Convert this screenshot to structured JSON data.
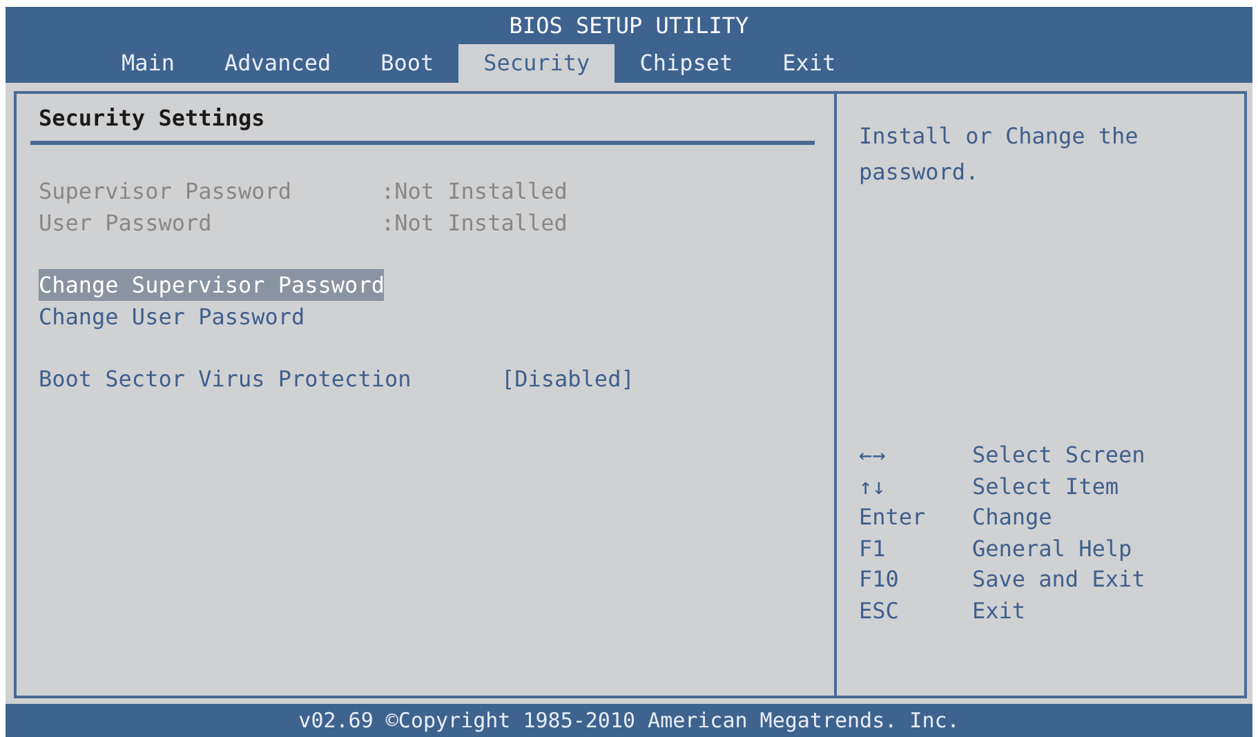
{
  "window": {
    "title": "BIOS SETUP UTILITY"
  },
  "tabs": [
    {
      "label": "Main",
      "selected": false
    },
    {
      "label": "Advanced",
      "selected": false
    },
    {
      "label": "Boot",
      "selected": false
    },
    {
      "label": "Security",
      "selected": true
    },
    {
      "label": "Chipset",
      "selected": false
    },
    {
      "label": "Exit",
      "selected": false
    }
  ],
  "panel": {
    "title": "Security Settings",
    "items": [
      {
        "kind": "info",
        "label": "Supervisor Password",
        "value": ":Not Installed",
        "selected": false
      },
      {
        "kind": "info",
        "label": "User Password",
        "value": ":Not Installed",
        "selected": false
      },
      {
        "kind": "gap"
      },
      {
        "kind": "action",
        "label": "Change Supervisor Password",
        "selected": true
      },
      {
        "kind": "action",
        "label": "Change User Password",
        "selected": false
      },
      {
        "kind": "gap"
      },
      {
        "kind": "option",
        "label": "Boot Sector Virus Protection",
        "value": "[Disabled]",
        "selected": false
      }
    ]
  },
  "help": {
    "text": "Install or Change the password.",
    "keys": [
      {
        "key": "←→",
        "action": "Select Screen"
      },
      {
        "key": "↑↓",
        "action": "Select Item"
      },
      {
        "key": "Enter",
        "action": "Change"
      },
      {
        "key": "F1",
        "action": "General Help"
      },
      {
        "key": "F10",
        "action": "Save and Exit"
      },
      {
        "key": "ESC",
        "action": "Exit"
      }
    ]
  },
  "status_bar": "v02.69 ©Copyright 1985-2010 American Megatrends. Inc."
}
